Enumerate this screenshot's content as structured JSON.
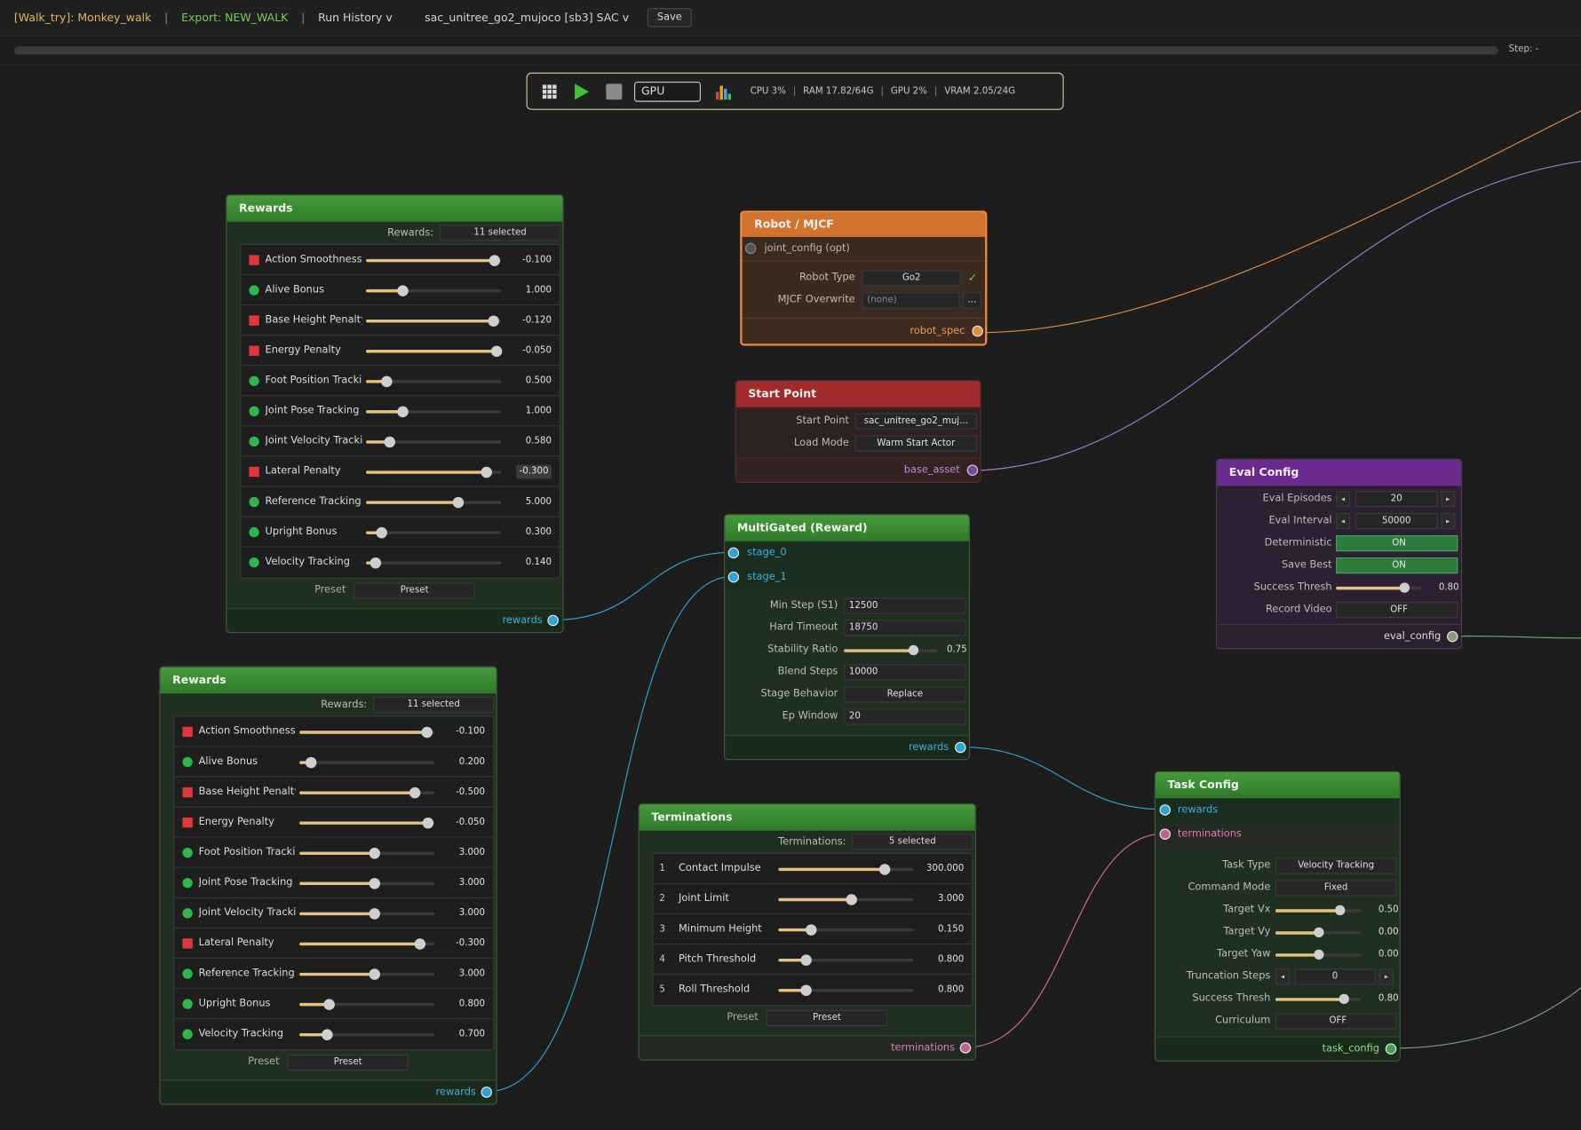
{
  "topbar": {
    "project": "[Walk_try]: Monkey_walk",
    "sep": "|",
    "export": "Export: NEW_WALK",
    "run_history": "Run History  v",
    "env": "sac_unitree_go2_mujoco  [sb3]  SAC  v",
    "save_label": "Save"
  },
  "progress": {
    "fraction": 0,
    "step_label": "Step: -"
  },
  "toolbar": {
    "device": "GPU",
    "cpu": "CPU 3%",
    "ram": "RAM 17.82/64G",
    "gpu": "GPU 2%",
    "vram": "VRAM 2.05/24G",
    "sep": "|"
  },
  "colors": {
    "accent": "#e7c27c",
    "penalty": "#e03838",
    "bonus": "#2cb84a",
    "reward_port": "#2ea3d6",
    "termination_port": "#d76aa6"
  },
  "rewards_a": {
    "title": "Rewards",
    "selector_label": "Rewards:",
    "selector_value": "11 selected",
    "preset_label": "Preset",
    "preset_value": "Preset",
    "output_label": "rewards",
    "items": [
      {
        "label": "Action Smoothness",
        "kind": "penalty",
        "value": "-0.100",
        "slider": 0.95
      },
      {
        "label": "Alive Bonus",
        "kind": "bonus",
        "value": "1.000",
        "slider": 0.27
      },
      {
        "label": "Base Height Penalty",
        "kind": "penalty",
        "value": "-0.120",
        "slider": 0.94
      },
      {
        "label": "Energy Penalty",
        "kind": "penalty",
        "value": "-0.050",
        "slider": 0.96
      },
      {
        "label": "Foot Position Tracking",
        "kind": "bonus",
        "value": "0.500",
        "slider": 0.15
      },
      {
        "label": "Joint Pose Tracking",
        "kind": "bonus",
        "value": "1.000",
        "slider": 0.27
      },
      {
        "label": "Joint Velocity Tracking",
        "kind": "bonus",
        "value": "0.580",
        "slider": 0.17
      },
      {
        "label": "Lateral Penalty",
        "kind": "penalty",
        "value": "-0.300",
        "slider": 0.89
      },
      {
        "label": "Reference Tracking",
        "kind": "bonus",
        "value": "5.000",
        "slider": 0.68
      },
      {
        "label": "Upright Bonus",
        "kind": "bonus",
        "value": "0.300",
        "slider": 0.11
      },
      {
        "label": "Velocity Tracking",
        "kind": "bonus",
        "value": "0.140",
        "slider": 0.07
      }
    ]
  },
  "rewards_b": {
    "title": "Rewards",
    "selector_label": "Rewards:",
    "selector_value": "11 selected",
    "preset_label": "Preset",
    "preset_value": "Preset",
    "output_label": "rewards",
    "items": [
      {
        "label": "Action Smoothness",
        "kind": "penalty",
        "value": "-0.100",
        "slider": 0.94
      },
      {
        "label": "Alive Bonus",
        "kind": "bonus",
        "value": "0.200",
        "slider": 0.08
      },
      {
        "label": "Base Height Penalty",
        "kind": "penalty",
        "value": "-0.500",
        "slider": 0.85
      },
      {
        "label": "Energy Penalty",
        "kind": "penalty",
        "value": "-0.050",
        "slider": 0.95
      },
      {
        "label": "Foot Position Tracking",
        "kind": "bonus",
        "value": "3.000",
        "slider": 0.55
      },
      {
        "label": "Joint Pose Tracking",
        "kind": "bonus",
        "value": "3.000",
        "slider": 0.55
      },
      {
        "label": "Joint Velocity Tracking",
        "kind": "bonus",
        "value": "3.000",
        "slider": 0.55
      },
      {
        "label": "Lateral Penalty",
        "kind": "penalty",
        "value": "-0.300",
        "slider": 0.89
      },
      {
        "label": "Reference Tracking",
        "kind": "bonus",
        "value": "3.000",
        "slider": 0.55
      },
      {
        "label": "Upright Bonus",
        "kind": "bonus",
        "value": "0.800",
        "slider": 0.22
      },
      {
        "label": "Velocity Tracking",
        "kind": "bonus",
        "value": "0.700",
        "slider": 0.2
      }
    ]
  },
  "robot": {
    "title": "Robot / MJCF",
    "input_label": "joint_config  (opt)",
    "robot_type_label": "Robot Type",
    "robot_type_value": "Go2",
    "check": "✓",
    "mjcf_label": "MJCF Overwrite",
    "mjcf_placeholder": "(none)",
    "browse": "...",
    "output_label": "robot_spec"
  },
  "start": {
    "title": "Start Point",
    "start_label": "Start Point",
    "start_value": "sac_unitree_go2_muj...",
    "load_label": "Load Mode",
    "load_value": "Warm Start Actor",
    "output_label": "base_asset"
  },
  "gated": {
    "title": "MultiGated (Reward)",
    "input_0": "stage_0",
    "input_1": "stage_1",
    "min_step_label": "Min Step (S1)",
    "min_step": "12500",
    "hard_timeout_label": "Hard Timeout",
    "hard_timeout": "18750",
    "stability_label": "Stability Ratio",
    "stability_value": "0.75",
    "stability": 0.75,
    "blend_label": "Blend Steps",
    "blend": "10000",
    "stage_behavior_label": "Stage Behavior",
    "stage_behavior": "Replace",
    "ep_window_label": "Ep Window",
    "ep_window": "20",
    "output_label": "rewards"
  },
  "eval": {
    "title": "Eval Config",
    "episodes_label": "Eval Episodes",
    "episodes": "20",
    "interval_label": "Eval Interval",
    "interval": "50000",
    "left_arrow": "◂",
    "right_arrow": "▸",
    "deterministic_label": "Deterministic",
    "deterministic": "ON",
    "save_best_label": "Save Best",
    "save_best": "ON",
    "success_label": "Success Thresh",
    "success_value": "0.80",
    "success": 0.8,
    "record_label": "Record Video",
    "record": "OFF",
    "output_label": "eval_config"
  },
  "terminations": {
    "title": "Terminations",
    "selector_label": "Terminations:",
    "selector_value": "5 selected",
    "preset_label": "Preset",
    "preset_value": "Preset",
    "output_label": "terminations",
    "items": [
      {
        "num": "1",
        "label": "Contact Impulse",
        "value": "300.000",
        "slider": 0.78
      },
      {
        "num": "2",
        "label": "Joint Limit",
        "value": "3.000",
        "slider": 0.54
      },
      {
        "num": "3",
        "label": "Minimum Height",
        "value": "0.150",
        "slider": 0.24
      },
      {
        "num": "4",
        "label": "Pitch Threshold",
        "value": "0.800",
        "slider": 0.2
      },
      {
        "num": "5",
        "label": "Roll Threshold",
        "value": "0.800",
        "slider": 0.2
      }
    ]
  },
  "task": {
    "title": "Task Config",
    "input_rewards": "rewards",
    "input_terminations": "terminations",
    "task_type_label": "Task Type",
    "task_type": "Velocity Tracking",
    "command_mode_label": "Command Mode",
    "command_mode": "Fixed",
    "vx_label": "Target Vx",
    "vx_value": "0.50",
    "vx": 0.5,
    "vy_label": "Target Vy",
    "vy_value": "0.00",
    "vy": 0.0,
    "yaw_label": "Target Yaw",
    "yaw_value": "0.00",
    "yaw": 0.0,
    "trunc_label": "Truncation Steps",
    "trunc": "0",
    "left_arrow": "◂",
    "right_arrow": "▸",
    "success_label": "Success Thresh",
    "success_value": "0.80",
    "success": 0.8,
    "curriculum_label": "Curriculum",
    "curriculum": "OFF",
    "output_label": "task_config"
  }
}
